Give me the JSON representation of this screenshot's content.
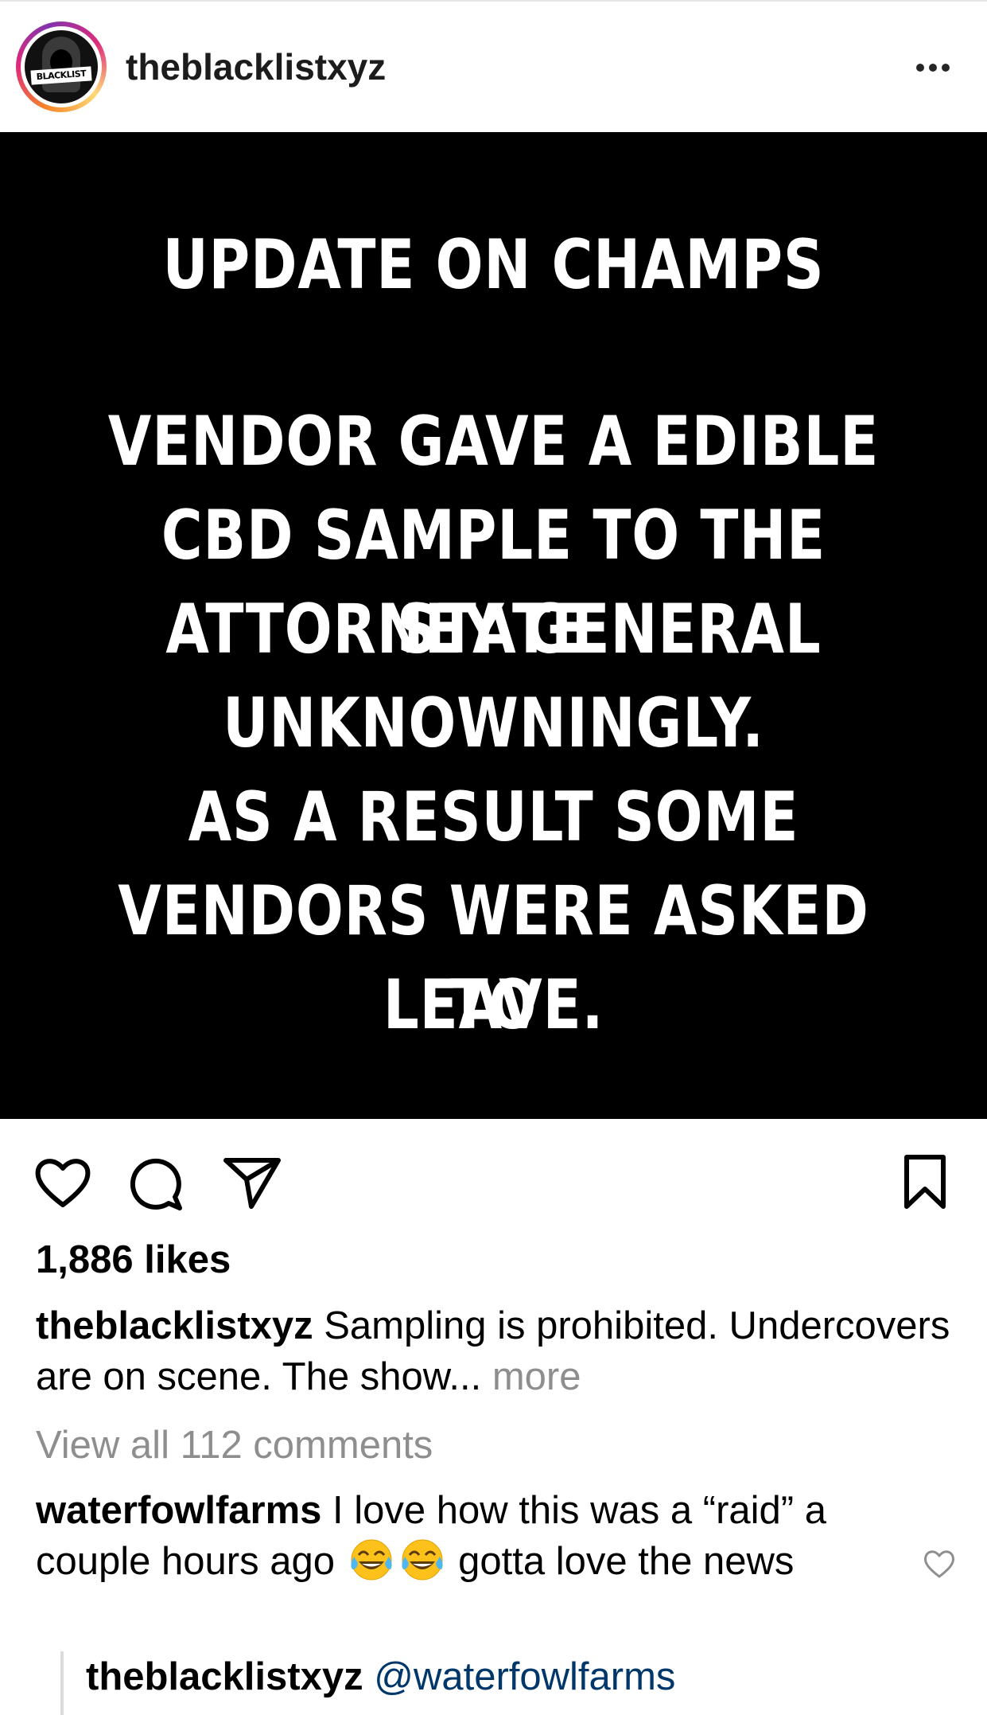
{
  "post": {
    "username": "theblacklistxyz",
    "avatar_text": "BLACKLIST",
    "image_text_lines": [
      "UPDATE ON CHAMPS",
      "VENDOR GAVE A EDIBLE",
      "CBD SAMPLE TO THE STATE",
      "ATTORNEY GENERAL",
      "UNKNOWNINGLY.",
      "AS A RESULT SOME",
      "VENDORS WERE ASKED TO",
      "LEAVE."
    ],
    "likes": "1,886 likes",
    "caption_user": "theblacklistxyz",
    "caption_text": " Sampling is prohibited. Undercovers are on scene. The show... ",
    "caption_more": "more",
    "view_all_comments": "View all 112 comments"
  },
  "comment": {
    "user": "waterfowlfarms",
    "text_part1": " I love how this was a “raid” a couple hours ago ",
    "text_part2": " gotta love the news",
    "emojis": [
      "face-with-tears-of-joy",
      "face-with-tears-of-joy"
    ]
  },
  "reply": {
    "user": "theblacklistxyz",
    "mention": "@waterfowlfarms"
  },
  "icons": {
    "more": "more-options-icon",
    "like": "heart-icon",
    "comment": "comment-bubble-icon",
    "share": "paper-plane-icon",
    "save": "bookmark-icon"
  }
}
